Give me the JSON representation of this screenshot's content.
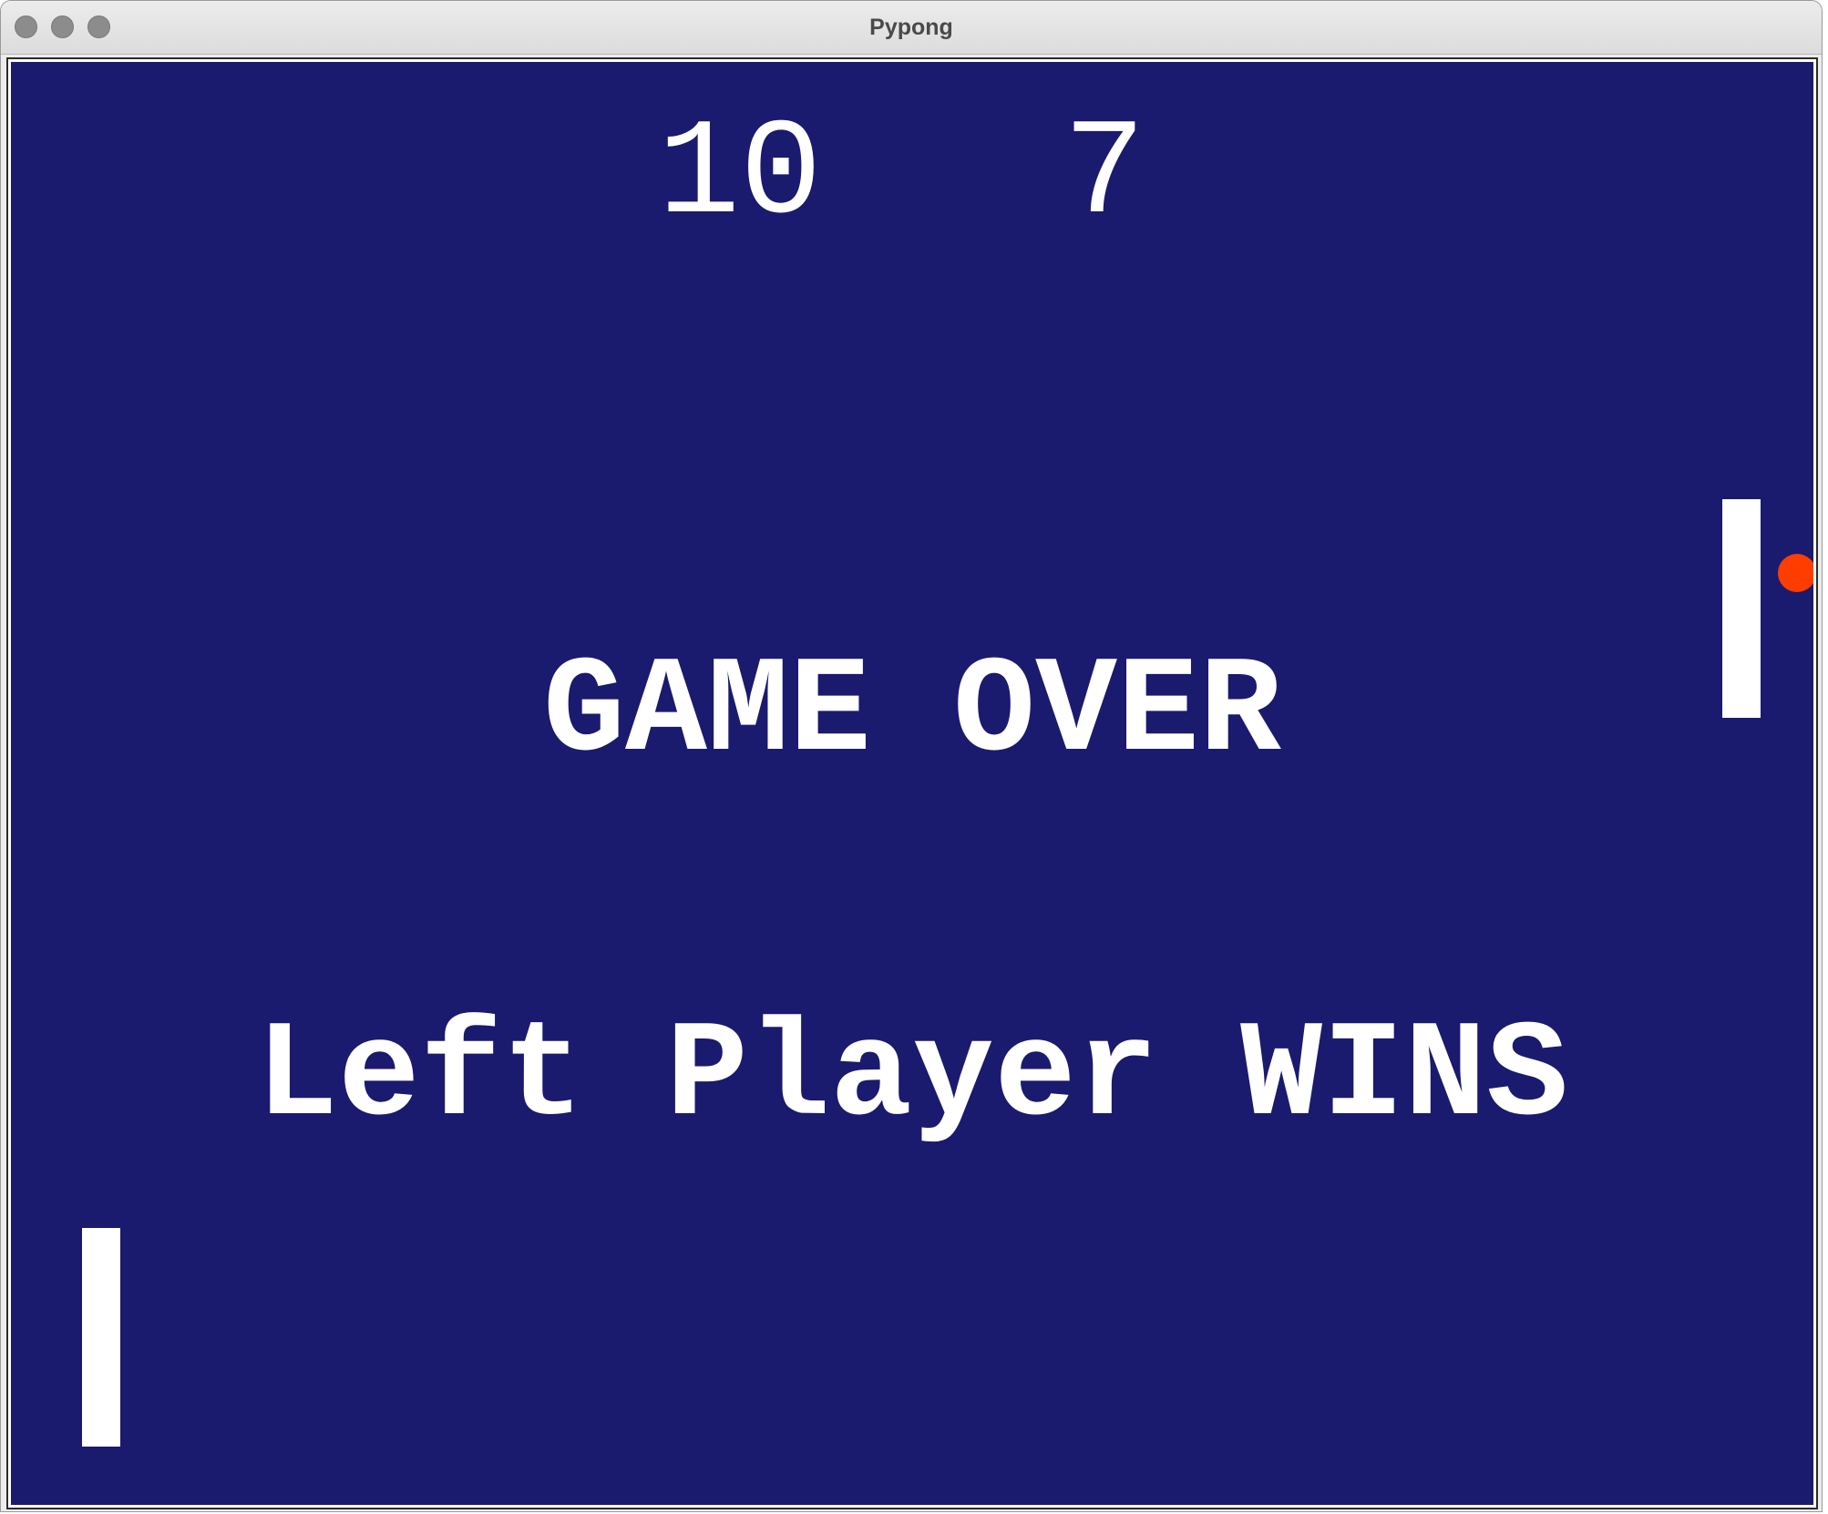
{
  "window": {
    "title": "Pypong"
  },
  "game": {
    "background_color": "#1a1a6e",
    "score": {
      "left": "10",
      "right": "7"
    },
    "game_over_text": "GAME OVER",
    "winner_text": "Left Player WINS",
    "ball": {
      "color": "#ff3d00"
    },
    "paddle_color": "#ffffff"
  }
}
